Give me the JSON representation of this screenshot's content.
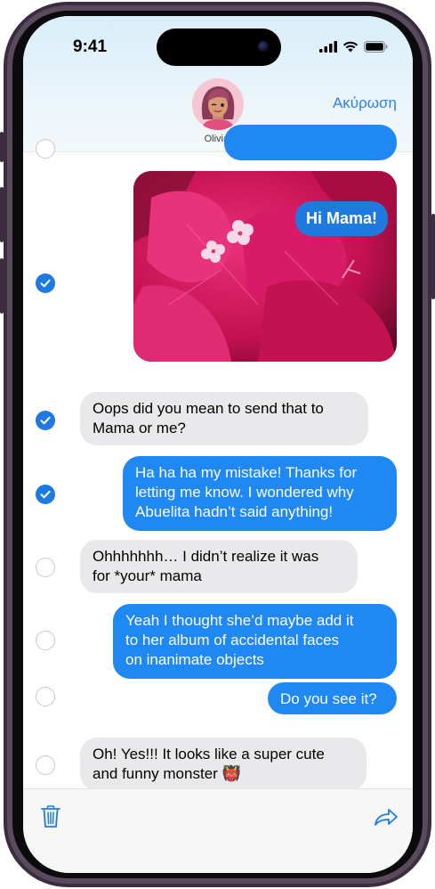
{
  "status_bar": {
    "time": "9:41"
  },
  "header": {
    "contact_name": "Olivia",
    "cancel_label": "Ακύρωση",
    "avatar_icon": "memoji-avatar-icon"
  },
  "photo_message": {
    "overlay_text": "Hi Mama!",
    "selected": true
  },
  "messages": [
    {
      "direction": "in",
      "text": "Oops did you mean to send that to\nMama or me?",
      "selected": true
    },
    {
      "direction": "out",
      "text": "Ha ha ha my mistake! Thanks for\nletting me know. I wondered why\nAbuelita hadn’t said anything!",
      "selected": true
    },
    {
      "direction": "in",
      "text": "Ohhhhhhh… I didn’t realize it was\nfor *your* mama",
      "selected": false
    },
    {
      "direction": "out",
      "text": "Yeah I thought she’d maybe add it\nto her album of accidental faces\non inanimate objects",
      "selected": false
    },
    {
      "direction": "out",
      "text": "Do you see it?",
      "selected": false
    },
    {
      "direction": "in",
      "text": "Oh! Yes!!! It looks like a super cute\nand funny monster 👹",
      "selected": false
    }
  ],
  "toolbar": {
    "delete_icon": "trash-icon",
    "share_icon": "share-arrow-icon"
  },
  "colors": {
    "accent": "#1f7ae0",
    "outgoing_bubble": "#1f88f3",
    "incoming_bubble": "#e9e9eb",
    "frame": "#3b2d3f"
  }
}
